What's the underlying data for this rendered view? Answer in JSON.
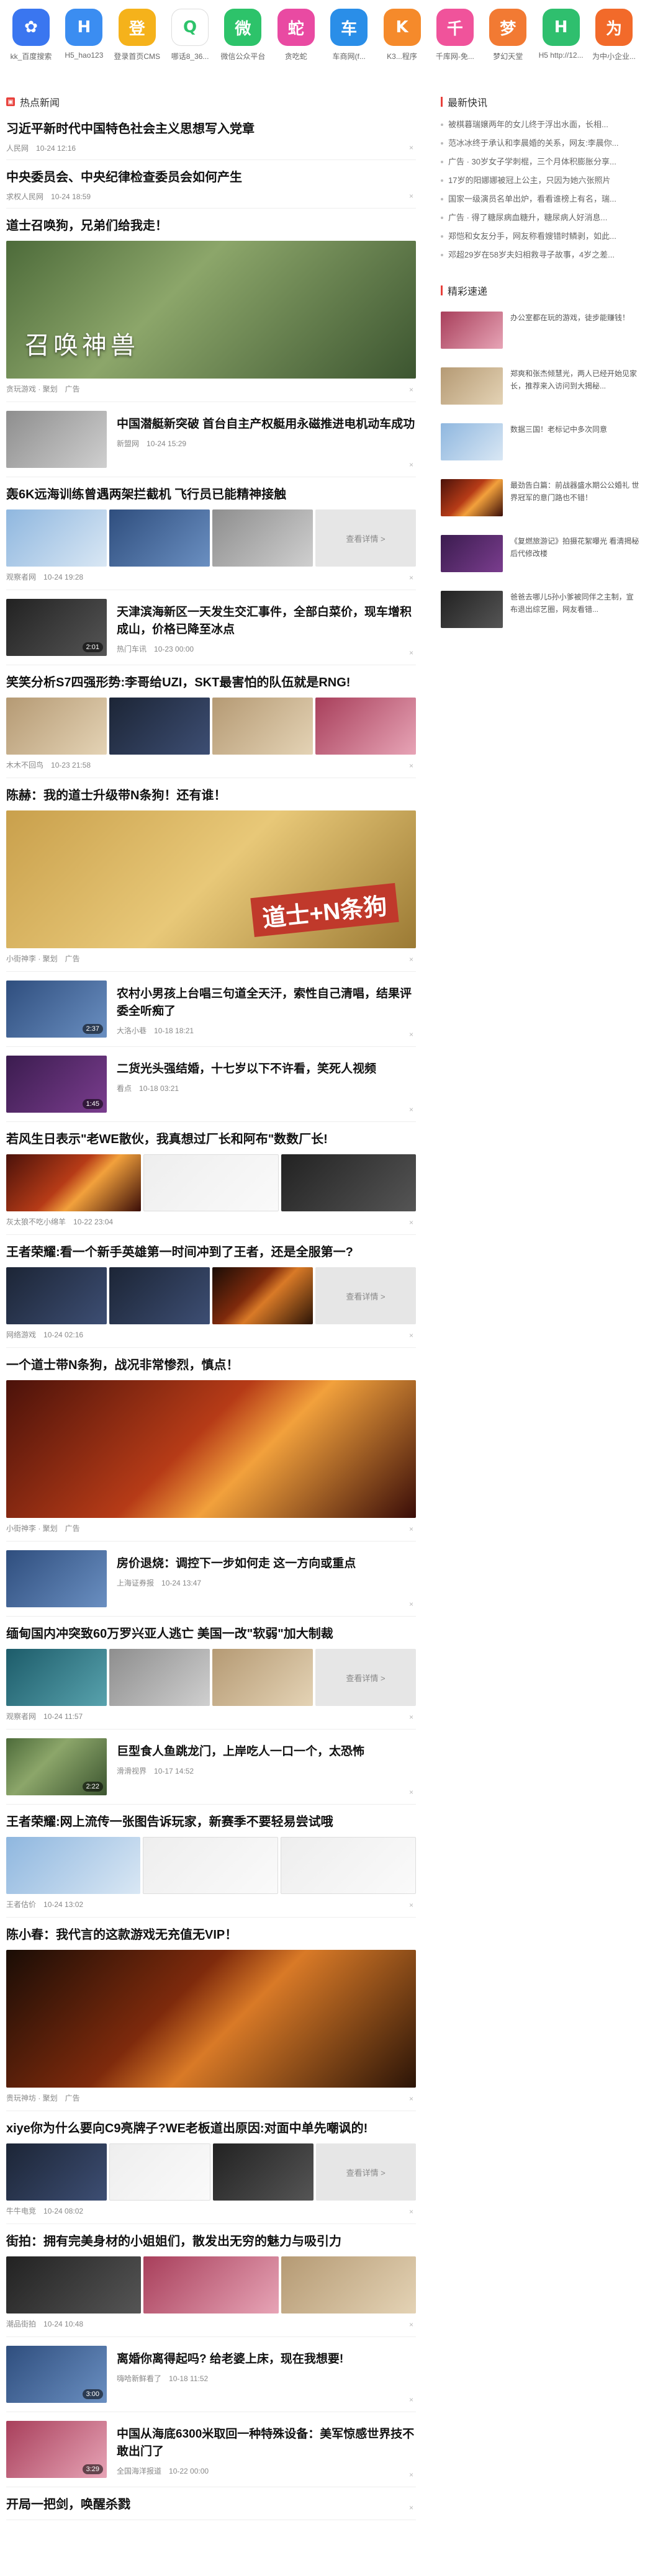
{
  "shortcuts": [
    {
      "icon": "paw-icon",
      "glyph": "✿",
      "color": "#3a76f0",
      "label": "kk_百度搜索"
    },
    {
      "icon": "h-icon",
      "glyph": "H",
      "color": "#3b8df1",
      "label": "H5_hao123"
    },
    {
      "icon": "login-icon",
      "glyph": "登",
      "color": "#f5b21b",
      "label": "登录首页CMS"
    },
    {
      "icon": "circle-icon",
      "glyph": "Q",
      "color": "#ffffff",
      "label": "哪话8_36..."
    },
    {
      "icon": "wechat-icon",
      "glyph": "微",
      "color": "#2dc36a",
      "label": "微信公众平台"
    },
    {
      "icon": "snake-icon",
      "glyph": "蛇",
      "color": "#e94aa2",
      "label": "贪吃蛇"
    },
    {
      "icon": "car-icon",
      "glyph": "车",
      "color": "#2a8ee8",
      "label": "车商网(f..."
    },
    {
      "icon": "k-icon",
      "glyph": "K",
      "color": "#f58a2b",
      "label": "K3...程序"
    },
    {
      "icon": "thousand-icon",
      "glyph": "千",
      "color": "#f0539b",
      "label": "千库网-免..."
    },
    {
      "icon": "dream-icon",
      "glyph": "梦",
      "color": "#f27a33",
      "label": "梦幻天堂"
    },
    {
      "icon": "h2-icon",
      "glyph": "H",
      "color": "#2fbf6e",
      "label": "H5 http://12..."
    },
    {
      "icon": "wei-icon",
      "glyph": "为",
      "color": "#f26a2a",
      "label": "为中小企业..."
    }
  ],
  "hot": {
    "heading": "热点新闻",
    "items": [
      {
        "type": "text",
        "title": "习近平新时代中国特色社会主义思想写入党章",
        "source": "人民网",
        "time": "10-24 12:16"
      },
      {
        "type": "text",
        "title": "中央委员会、中央纪律检查委员会如何产生",
        "source": "求权人民网",
        "time": "10-24 18:59"
      },
      {
        "type": "big",
        "title": "道士召唤狗，兄弟们给我走！",
        "source": "贪玩游戏 · 聚划",
        "time": "广告",
        "img": "g-green",
        "caption": "召唤神兽"
      },
      {
        "type": "side",
        "title": "中国潜艇新突破 首台自主产权艇用永磁推进电机动车成功",
        "source": "新盟网",
        "time": "10-24 15:29",
        "img": "g-gray"
      },
      {
        "type": "row3",
        "title": "轰6K远海训练曾遇两架拦截机 飞行员已能精神接触",
        "source": "观察者网",
        "time": "10-24 19:28",
        "imgs": [
          "g-sky",
          "g-blue",
          "g-gray"
        ],
        "more": "查看详情 >"
      },
      {
        "type": "side",
        "title": "天津滨海新区一天发生交汇事件，全部白菜价，现车增积成山，价格已降至冰点",
        "source": "热门车讯",
        "time": "10-23 00:00",
        "img": "g-dark",
        "dur": "2:01"
      },
      {
        "type": "row3",
        "title": "笑笑分析S7四强形势:李哥给UZI，SKT最害怕的队伍就是RNG!",
        "source": "木木不回鸟",
        "time": "10-23 21:58",
        "imgs": [
          "g-beige",
          "g-game",
          "g-beige",
          "g-pink"
        ]
      },
      {
        "type": "big",
        "title": "陈赫：我的道士升级带N条狗！还有谁！",
        "source": "小街神李 · 聚划",
        "time": "广告",
        "img": "g-gold",
        "caption2": "道士+N条狗"
      },
      {
        "type": "side",
        "title": "农村小男孩上台唱三句道全天汗，索性自己清唱，结果评委全听痴了",
        "source": "大洛小巷",
        "time": "10-18 18:21",
        "img": "g-blue",
        "dur": "2:37"
      },
      {
        "type": "side",
        "title": "二货光头强结婚，十七岁以下不许看，笑死人视频",
        "source": "看点",
        "time": "10-18 03:21",
        "img": "g-purple",
        "dur": "1:45"
      },
      {
        "type": "row3",
        "title": "若风生日表示\"老WE散伙，我真想过厂长和阿布\"数数厂长!",
        "source": "灰太狼不吃小绵羊",
        "time": "10-22 23:04",
        "imgs": [
          "g-red",
          "g-white",
          "g-dark"
        ]
      },
      {
        "type": "row3",
        "title": "王者荣耀:看一个新手英雄第一时间冲到了王者，还是全服第一?",
        "source": "网络游戏",
        "time": "10-24 02:16",
        "imgs": [
          "g-game",
          "g-game",
          "g-fire"
        ],
        "more": "查看详情 >"
      },
      {
        "type": "big",
        "title": "一个道士带N条狗，战况非常惨烈，慎点！",
        "source": "小街神李 · 聚划",
        "time": "广告",
        "img": "g-red"
      },
      {
        "type": "side",
        "title": "房价退烧：调控下一步如何走 这一方向或重点",
        "source": "上海证券报",
        "time": "10-24 13:47",
        "img": "g-blue"
      },
      {
        "type": "row3",
        "title": "缅甸国内冲突致60万罗兴亚人逃亡 美国一改\"软弱\"加大制裁",
        "source": "观察者网",
        "time": "10-24 11:57",
        "imgs": [
          "g-teal",
          "g-gray",
          "g-beige"
        ],
        "more": "查看详情 >"
      },
      {
        "type": "side",
        "title": "巨型食人鱼跳龙门，上岸吃人一口一个，太恐怖",
        "source": "滑滑视界",
        "time": "10-17 14:52",
        "img": "g-green",
        "dur": "2:22"
      },
      {
        "type": "row3",
        "title": "王者荣耀:网上流传一张图告诉玩家，新赛季不要轻易尝试哦",
        "source": "王者估价",
        "time": "10-24 13:02",
        "imgs": [
          "g-sky",
          "g-white",
          "g-white"
        ]
      },
      {
        "type": "big",
        "title": "陈小春：我代言的这款游戏无充值无VIP！",
        "source": "贵玩神坊 · 聚划",
        "time": "广告",
        "img": "g-fire"
      },
      {
        "type": "row3",
        "title": "xiye你为什么要向C9亮牌子?WE老板道出原因:对面中单先嘲讽的!",
        "source": "牛牛电竞",
        "time": "10-24 08:02",
        "imgs": [
          "g-game",
          "g-white",
          "g-dark"
        ],
        "more": "查看详情 >"
      },
      {
        "type": "row3",
        "title": "街拍：拥有完美身材的小姐姐们，散发出无穷的魅力与吸引力",
        "source": "潮品街拍",
        "time": "10-24 10:48",
        "imgs": [
          "g-dark",
          "g-pink",
          "g-beige"
        ]
      },
      {
        "type": "side",
        "title": "离婚你离得起吗? 给老婆上床，现在我想要!",
        "source": "嗨哈新鲜看了",
        "time": "10-18 11:52",
        "img": "g-blue",
        "dur": "3:00"
      },
      {
        "type": "side",
        "title": "中国从海底6300米取回一种特殊设备：美军惊感世界技不敢出门了",
        "source": "全国海洋报道",
        "time": "10-22 00:00",
        "img": "g-pink",
        "dur": "3:29"
      },
      {
        "type": "text",
        "title": "开局一把剑，唤醒杀戮",
        "source": "",
        "time": ""
      }
    ]
  },
  "latest": {
    "heading": "最新快讯",
    "items": [
      "被棋暮瑞嬢两年的女儿终于浮出水面，长相...",
      "范冰冰终于承认和李晨婚的关系，网友:李晨你...",
      "广告 · 30岁女子学刺棍，三个月体积膨胀分享...",
      "17岁的阳娜娜被冠上公主，只因为她六张照片",
      "国家一级演员名单出炉，看看谁榜上有名，瑞...",
      "广告 · 得了糖尿病血糖升，糖尿病人好消息...",
      "郑恺和女友分手，网友称看嫂错时鳞剥，如此...",
      "邓超29岁在58岁夫妇相救寻子故事，4岁之差..."
    ]
  },
  "picks": {
    "heading": "精彩速递",
    "items": [
      {
        "img": "g-pink",
        "text": "办公室都在玩的游戏，徒步能赚钱！"
      },
      {
        "img": "g-beige",
        "text": "郑爽和张杰倾慧光，两人已经开始见家长，推荐来入访问到大揭秘..."
      },
      {
        "img": "g-sky",
        "text": "数据三国！老标记中多次同意"
      },
      {
        "img": "g-red",
        "text": "最劲告白篇：前战器盛水期公公婚礼 世界冠军的意门路也不错！"
      },
      {
        "img": "g-purple",
        "text": "《复燃旅游记》拍摄花絮曝光 看清揭秘后代修改楼"
      },
      {
        "img": "g-dark",
        "text": "爸爸去哪儿5孙小爹被同伴之主制，宣布退出综艺圈，网友看错..."
      }
    ]
  }
}
